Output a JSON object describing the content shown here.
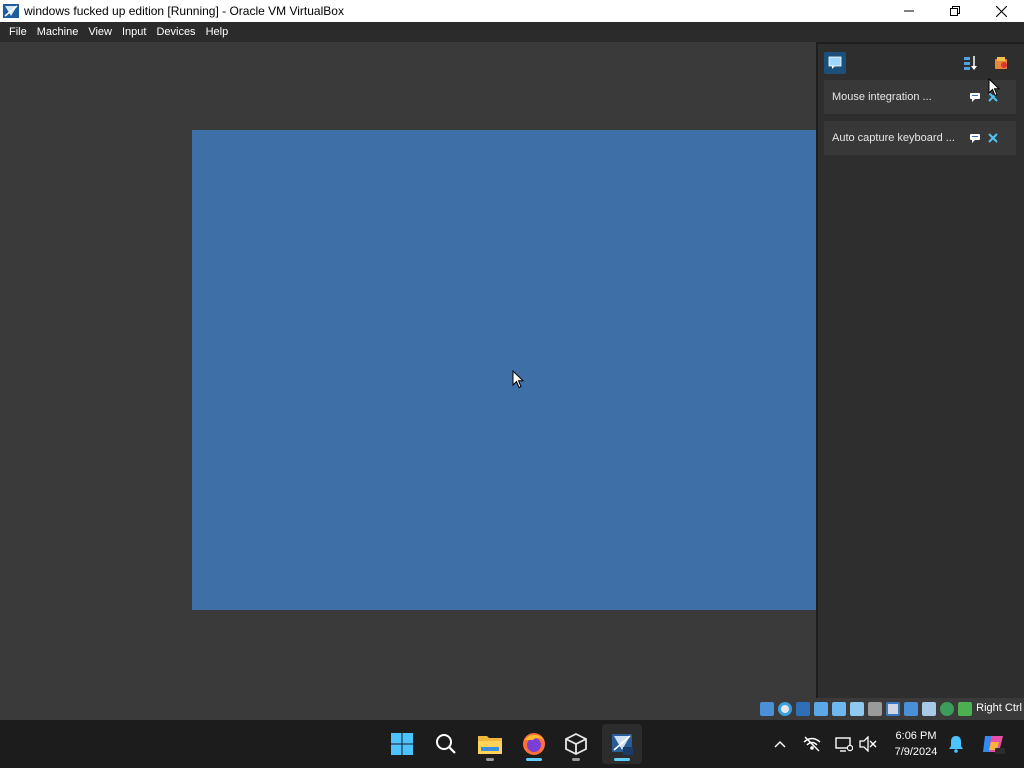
{
  "window": {
    "title": "windows fucked up edition [Running] - Oracle VM VirtualBox",
    "controls": [
      "minimize-icon",
      "maximize-icon",
      "close-icon"
    ]
  },
  "menu": {
    "items": [
      "File",
      "Machine",
      "View",
      "Input",
      "Devices",
      "Help"
    ]
  },
  "guest": {
    "screen_color": "#3e6fa6"
  },
  "notifications": {
    "toolbar_icons": [
      "notification-center-icon",
      "sort-icon",
      "keep-finished-icon"
    ],
    "items": [
      {
        "label": "Mouse integration ..."
      },
      {
        "label": "Auto capture keyboard ..."
      }
    ]
  },
  "statusbar": {
    "icons": [
      "hard-disk-icon",
      "optical-drive-icon",
      "floppy-icon",
      "audio-icon",
      "network-icon",
      "usb-icon",
      "shared-folders-icon",
      "display-icon",
      "recording-icon",
      "cpu-icon",
      "mouse-integration-icon",
      "keyboard-icon",
      "host-key-icon"
    ],
    "host_key": "Right Ctrl"
  },
  "taskbar": {
    "apps": [
      "start-icon",
      "search-icon",
      "file-explorer-icon",
      "firefox-icon",
      "virtualbox-icon",
      "virtualbox-vm-icon"
    ],
    "tray": [
      "show-hidden-icons-chevron",
      "network-disconnected-icon",
      "remote-display-icon",
      "volume-muted-icon",
      "notifications-bell-icon",
      "copilot-icon"
    ],
    "time": "6:06 PM",
    "date": "7/9/2024"
  },
  "colors": {
    "accent": "#60cdff",
    "notification_close": "#4fc3f7",
    "guest_blue": "#3e6fa6"
  }
}
